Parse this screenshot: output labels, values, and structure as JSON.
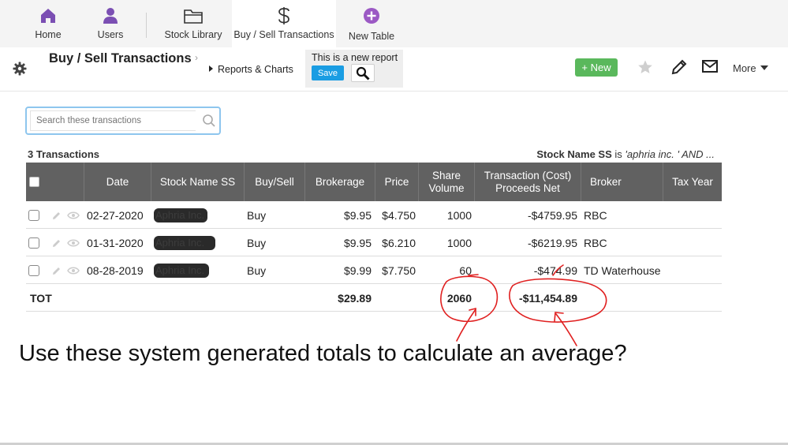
{
  "nav": {
    "items": [
      {
        "label": "Home",
        "icon": "home-icon"
      },
      {
        "label": "Users",
        "icon": "user-icon"
      },
      {
        "label": "Stock Library",
        "icon": "folder-icon"
      },
      {
        "label": "Buy / Sell Transactions",
        "icon": "dollar-icon"
      },
      {
        "label": "New Table",
        "icon": "plus-circle-icon"
      }
    ],
    "active": "Buy / Sell Transactions"
  },
  "header": {
    "title": "Buy / Sell Transactions",
    "reports_label": "Reports & Charts",
    "new_report_text": "This is a new report",
    "save_label": "Save",
    "new_label": "+ New",
    "more_label": "More"
  },
  "search": {
    "placeholder": "Search these transactions"
  },
  "summary": {
    "count": "3 Transactions",
    "filter_field": "Stock Name SS",
    "filter_op": "is",
    "filter_value": "'aphria inc. ' AND ..."
  },
  "table": {
    "columns": [
      "Date",
      "Stock Name SS",
      "Buy/Sell",
      "Brokerage",
      "Price",
      "Share Volume",
      "Transaction (Cost) Proceeds Net",
      "Broker",
      "Tax Year"
    ],
    "rows": [
      {
        "date": "02-27-2020",
        "stock": "Aphria Inc.",
        "buysell": "Buy",
        "brokerage": "$9.95",
        "price": "$4.750",
        "volume": "1000",
        "net": "-$4759.95",
        "broker": "RBC",
        "tax_year": ""
      },
      {
        "date": "01-31-2020",
        "stock": "Aphria Inc.",
        "buysell": "Buy",
        "brokerage": "$9.95",
        "price": "$6.210",
        "volume": "1000",
        "net": "-$6219.95",
        "broker": "RBC",
        "tax_year": ""
      },
      {
        "date": "08-28-2019",
        "stock": "Aphria Inc.",
        "buysell": "Buy",
        "brokerage": "$9.99",
        "price": "$7.750",
        "volume": "60",
        "net": "-$474.99",
        "broker": "TD Waterhouse",
        "tax_year": ""
      }
    ],
    "totals": {
      "label": "TOT",
      "brokerage": "$29.89",
      "volume": "2060",
      "net": "-$11,454.89"
    }
  },
  "annotation": {
    "question": "Use these system generated totals to calculate an average?",
    "color": "#e02020"
  },
  "colors": {
    "accent": "#1a9de3",
    "new_button": "#5ab85c",
    "table_header": "#616161",
    "nav_icon": "#7b4fb3"
  }
}
